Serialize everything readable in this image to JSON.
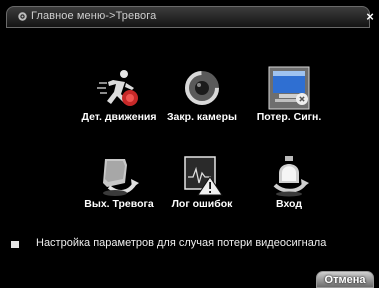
{
  "window": {
    "title": "Главное меню->Тревога",
    "close_glyph": "×"
  },
  "tiles": [
    {
      "label": "Дет. движения",
      "icon": "motion-detection-icon",
      "selected": false
    },
    {
      "label": "Закр. камеры",
      "icon": "camera-blind-icon",
      "selected": false
    },
    {
      "label": "Потер. Сигн.",
      "icon": "video-loss-icon",
      "selected": true
    },
    {
      "label": "Вых. Тревога",
      "icon": "alarm-output-icon",
      "selected": false
    },
    {
      "label": "Лог ошибок",
      "icon": "error-log-icon",
      "selected": false
    },
    {
      "label": "Вход",
      "icon": "alarm-input-icon",
      "selected": false
    }
  ],
  "option": {
    "text": "Настройка параметров для случая потери видеосигнала"
  },
  "footer": {
    "cancel_label": "Отмена"
  }
}
